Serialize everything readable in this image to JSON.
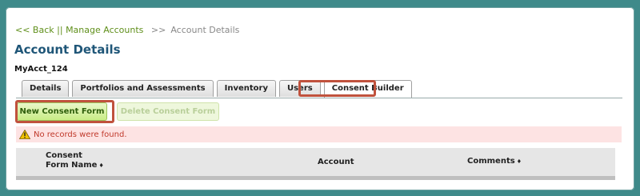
{
  "breadcrumb": {
    "back": "<< Back",
    "divider": "||",
    "manage": "Manage Accounts",
    "arrow": ">>",
    "current": "Account Details"
  },
  "page": {
    "title": "Account Details",
    "account_name": "MyAcct_124"
  },
  "tabs": [
    {
      "label": "Details"
    },
    {
      "label": "Portfolios and Assessments"
    },
    {
      "label": "Inventory"
    },
    {
      "label": "Users"
    },
    {
      "label": "Consent Builder",
      "active": true
    }
  ],
  "toolbar": {
    "new_label": "New Consent Form",
    "delete_label": "Delete Consent Form"
  },
  "alert": {
    "message": "No records were found.",
    "icon": "warning-icon",
    "color": "#c0392b"
  },
  "grid": {
    "columns": [
      {
        "label_line1": "Consent",
        "label_line2": "Form Name",
        "sort_icon": "♦"
      },
      {
        "label": "Account"
      },
      {
        "label": "Comments",
        "sort_icon": "♦"
      }
    ]
  },
  "colors": {
    "highlight": "#c0523d",
    "title": "#1f5678",
    "link": "#5f8f1a"
  }
}
